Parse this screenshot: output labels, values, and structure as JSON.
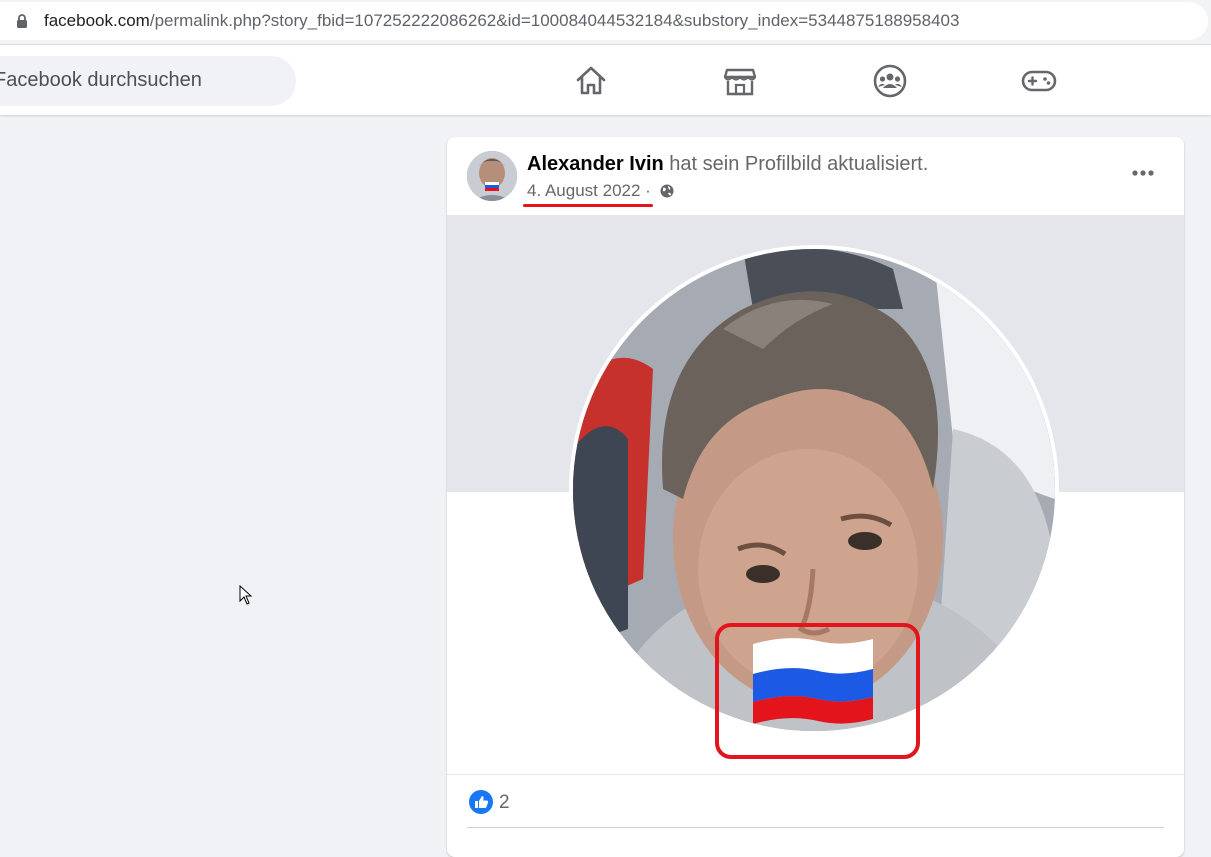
{
  "browser": {
    "url_host": "facebook.com",
    "url_path": "/permalink.php?story_fbid=107252222086262&id=100084044532184&substory_index=5344875188958403"
  },
  "header": {
    "search_placeholder": "Facebook durchsuchen",
    "nav_icons": [
      "home-icon",
      "marketplace-icon",
      "groups-icon",
      "gaming-icon"
    ]
  },
  "post": {
    "author": "Alexander Ivin",
    "action": " hat sein Profilbild aktualisiert.",
    "date": "4. August 2022",
    "separator": " · ",
    "privacy_icon": "globe-icon",
    "like_count": "2"
  },
  "colors": {
    "facebook_bg": "#f0f2f5",
    "like_blue": "#1877f2",
    "annotation_red": "#e3141c"
  }
}
